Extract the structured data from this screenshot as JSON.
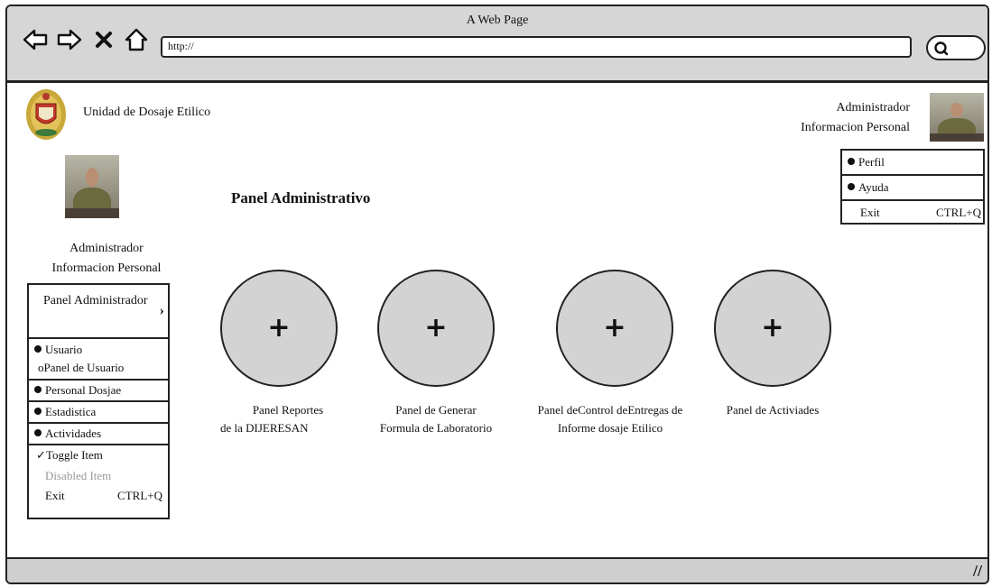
{
  "window": {
    "title": "A Web Page"
  },
  "toolbar": {
    "url": "http://"
  },
  "header": {
    "org_name": "Unidad de Dosaje Etilico",
    "user_role": "Administrador",
    "user_info": "Informacion Personal"
  },
  "user_menu": {
    "items": [
      "Perfil",
      "Ayuda"
    ],
    "exit_label": "Exit",
    "exit_shortcut": "CTRL+Q"
  },
  "sidebar": {
    "user_role": "Administrador",
    "user_info": "Informacion Personal",
    "menu": {
      "header": "Panel Administrador",
      "items": [
        "Usuario",
        "Personal Dosjae",
        "Estadistica",
        "Actividades"
      ],
      "usuario_sub": "oPanel de Usuario",
      "toggle_item": "Toggle Item",
      "disabled_item": "Disabled Item",
      "exit_label": "Exit",
      "exit_shortcut": "CTRL+Q"
    }
  },
  "main": {
    "title": "Panel Administrativo",
    "panels": [
      {
        "line1": "Panel Reportes",
        "line2": "de la DIJERESAN"
      },
      {
        "line1": "Panel de Generar",
        "line2": "Formula de Laboratorio"
      },
      {
        "line1": "Panel deControl deEntregas de",
        "line2": "Informe dosaje Etilico"
      },
      {
        "line1": "Panel de Activiades",
        "line2": ""
      }
    ]
  },
  "icons": {
    "back": "back-arrow-icon",
    "forward": "forward-arrow-icon",
    "stop": "close-icon",
    "home": "home-icon",
    "search": "search-icon",
    "add": "plus-icon",
    "resize": "resize-grip-icon"
  }
}
